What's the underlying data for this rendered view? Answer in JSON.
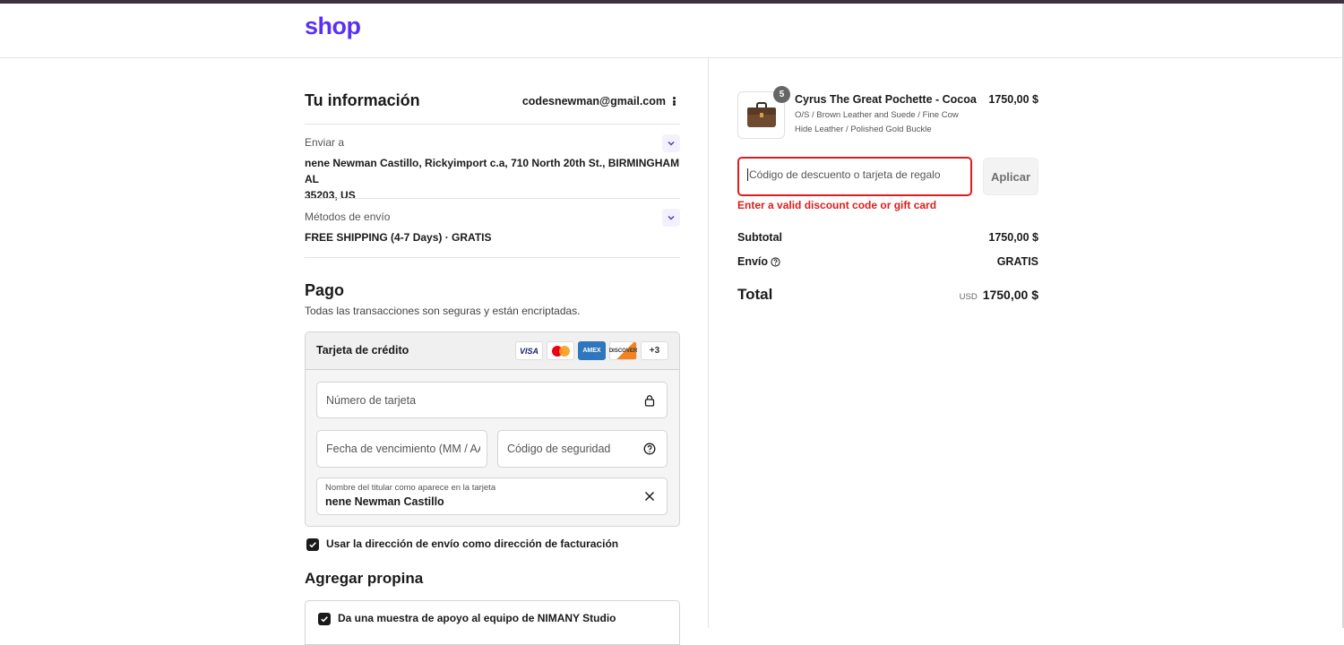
{
  "brand": {
    "logo": "shop",
    "accent": "#5a31f4"
  },
  "contact": {
    "title": "Tu información",
    "email": "codesnewman@gmail.com",
    "menu_icon": "more-vertical-icon"
  },
  "ship_to": {
    "label": "Enviar a",
    "address_line1": "nene Newman Castillo, Rickyimport c.a, 710 North 20th St., BIRMINGHAM AL",
    "address_line2": "35203, US"
  },
  "shipping_method": {
    "label": "Métodos de envío",
    "value": "FREE SHIPPING (4-7 Days) · GRATIS"
  },
  "payment": {
    "title": "Pago",
    "subtitle": "Todas las transacciones son seguras y están encriptadas.",
    "method_title": "Tarjeta de crédito",
    "brands": {
      "visa": "VISA",
      "amex": "AMEX",
      "discover": "DISCOVER",
      "more": "+3"
    },
    "card_number_placeholder": "Número de tarjeta",
    "expiry_placeholder": "Fecha de vencimiento (MM / AA)",
    "cvv_placeholder": "Código de seguridad",
    "name_label": "Nombre del titular como aparece en la tarjeta",
    "name_value": "nene Newman Castillo",
    "billing_same_label": "Usar la dirección de envío como dirección de facturación",
    "billing_same_checked": true
  },
  "tip": {
    "title": "Agregar propina",
    "option_label": "Da una muestra de apoyo al equipo de NIMANY Studio",
    "option_checked": true
  },
  "order": {
    "item": {
      "quantity": "5",
      "name": "Cyrus The Great Pochette - Cocoa",
      "variant_line1": "O/S / Brown Leather and Suede / Fine Cow",
      "variant_line2": "Hide Leather / Polished Gold Buckle",
      "price": "1750,00 $"
    },
    "discount": {
      "placeholder": "Código de descuento o tarjeta de regalo",
      "apply_label": "Aplicar",
      "error": "Enter a valid discount code or gift card",
      "error_color": "#dd1d1d"
    },
    "subtotal_label": "Subtotal",
    "subtotal_value": "1750,00 $",
    "shipping_label": "Envío",
    "shipping_value": "GRATIS",
    "total_label": "Total",
    "currency": "USD",
    "total_value": "1750,00 $"
  }
}
